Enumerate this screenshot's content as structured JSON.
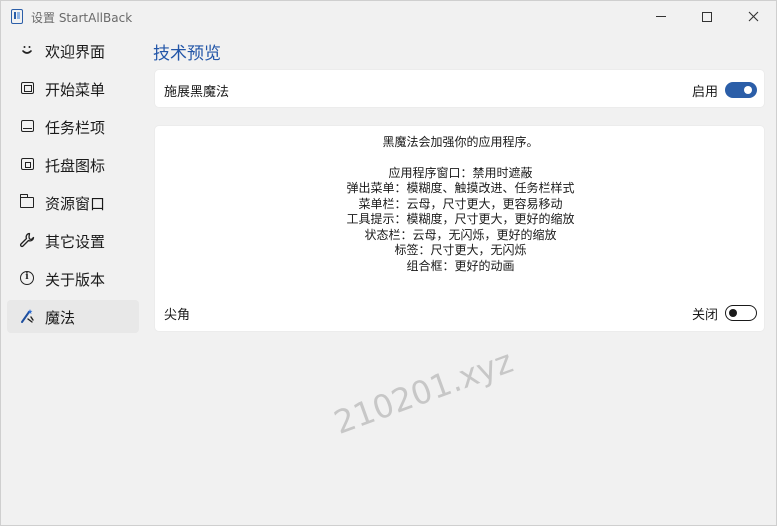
{
  "window": {
    "title": "设置 StartAllBack"
  },
  "sidebar": {
    "items": [
      {
        "label": "欢迎界面",
        "icon": "smile-icon"
      },
      {
        "label": "开始菜单",
        "icon": "start-menu-icon"
      },
      {
        "label": "任务栏项",
        "icon": "taskbar-icon"
      },
      {
        "label": "托盘图标",
        "icon": "tray-icon"
      },
      {
        "label": "资源窗口",
        "icon": "folder-icon"
      },
      {
        "label": "其它设置",
        "icon": "wrench-icon"
      },
      {
        "label": "关于版本",
        "icon": "info-icon"
      },
      {
        "label": "魔法",
        "icon": "magic-icon",
        "active": true
      }
    ]
  },
  "main": {
    "page_title": "技术预览",
    "black_magic": {
      "label": "施展黑魔法",
      "toggle_text": "启用",
      "enabled": true
    },
    "description": {
      "intro": "黑魔法会加强你的应用程序。",
      "lines": [
        "应用程序窗口：禁用时遮蔽",
        "弹出菜单：模糊度、触摸改进、任务栏样式",
        "菜单栏：云母，尺寸更大，更容易移动",
        "工具提示：模糊度，尺寸更大，更好的缩放",
        "状态栏：云母，无闪烁，更好的缩放",
        "标签：尺寸更大，无闪烁",
        "组合框：更好的动画"
      ]
    },
    "sharp_corners": {
      "label": "尖角",
      "toggle_text": "关闭",
      "enabled": false
    }
  },
  "watermark": "210201.xyz",
  "colors": {
    "accent": "#2b5ea8",
    "title": "#2356a8",
    "background": "#f1f1f1",
    "card": "#ffffff"
  }
}
